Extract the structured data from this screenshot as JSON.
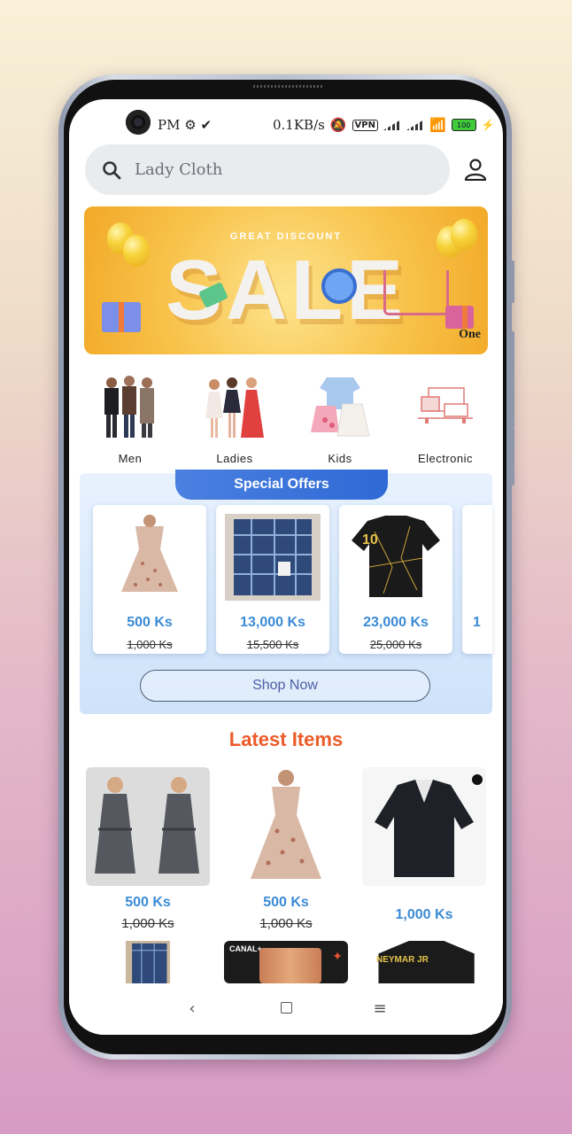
{
  "status_bar": {
    "time_suffix": "PM",
    "network_speed": "0.1KB/s",
    "vpn": "VPN",
    "battery": "100"
  },
  "search": {
    "placeholder": "Lady Cloth"
  },
  "banner": {
    "headline": "GREAT DISCOUNT",
    "sale_text": "SALE",
    "brand": "One"
  },
  "categories": [
    {
      "label": "Men"
    },
    {
      "label": "Ladies"
    },
    {
      "label": "Kids"
    },
    {
      "label": "Electronic"
    }
  ],
  "special_offers": {
    "title": "Special Offers",
    "products": [
      {
        "price": "500 Ks",
        "old_price": "1,000 Ks"
      },
      {
        "price": "13,000 Ks",
        "old_price": "15,500 Ks"
      },
      {
        "price": "23,000 Ks",
        "old_price": "25,000 Ks"
      },
      {
        "price": "1"
      }
    ],
    "shop_now": "Shop Now"
  },
  "latest": {
    "title": "Latest Items",
    "items": [
      {
        "price": "500 Ks",
        "old_price": "1,000 Ks"
      },
      {
        "price": "500 Ks",
        "old_price": "1,000 Ks"
      },
      {
        "price": "1,000 Ks"
      }
    ],
    "row2": [
      {
        "image": "plaid-shirt"
      },
      {
        "image_text": "CANAL+"
      },
      {
        "image_text": "NEYMAR JR"
      }
    ]
  },
  "colors": {
    "accent_blue": "#3b8bd6",
    "latest_title": "#ec5b2a",
    "offers_tab": "#2f69d6"
  }
}
